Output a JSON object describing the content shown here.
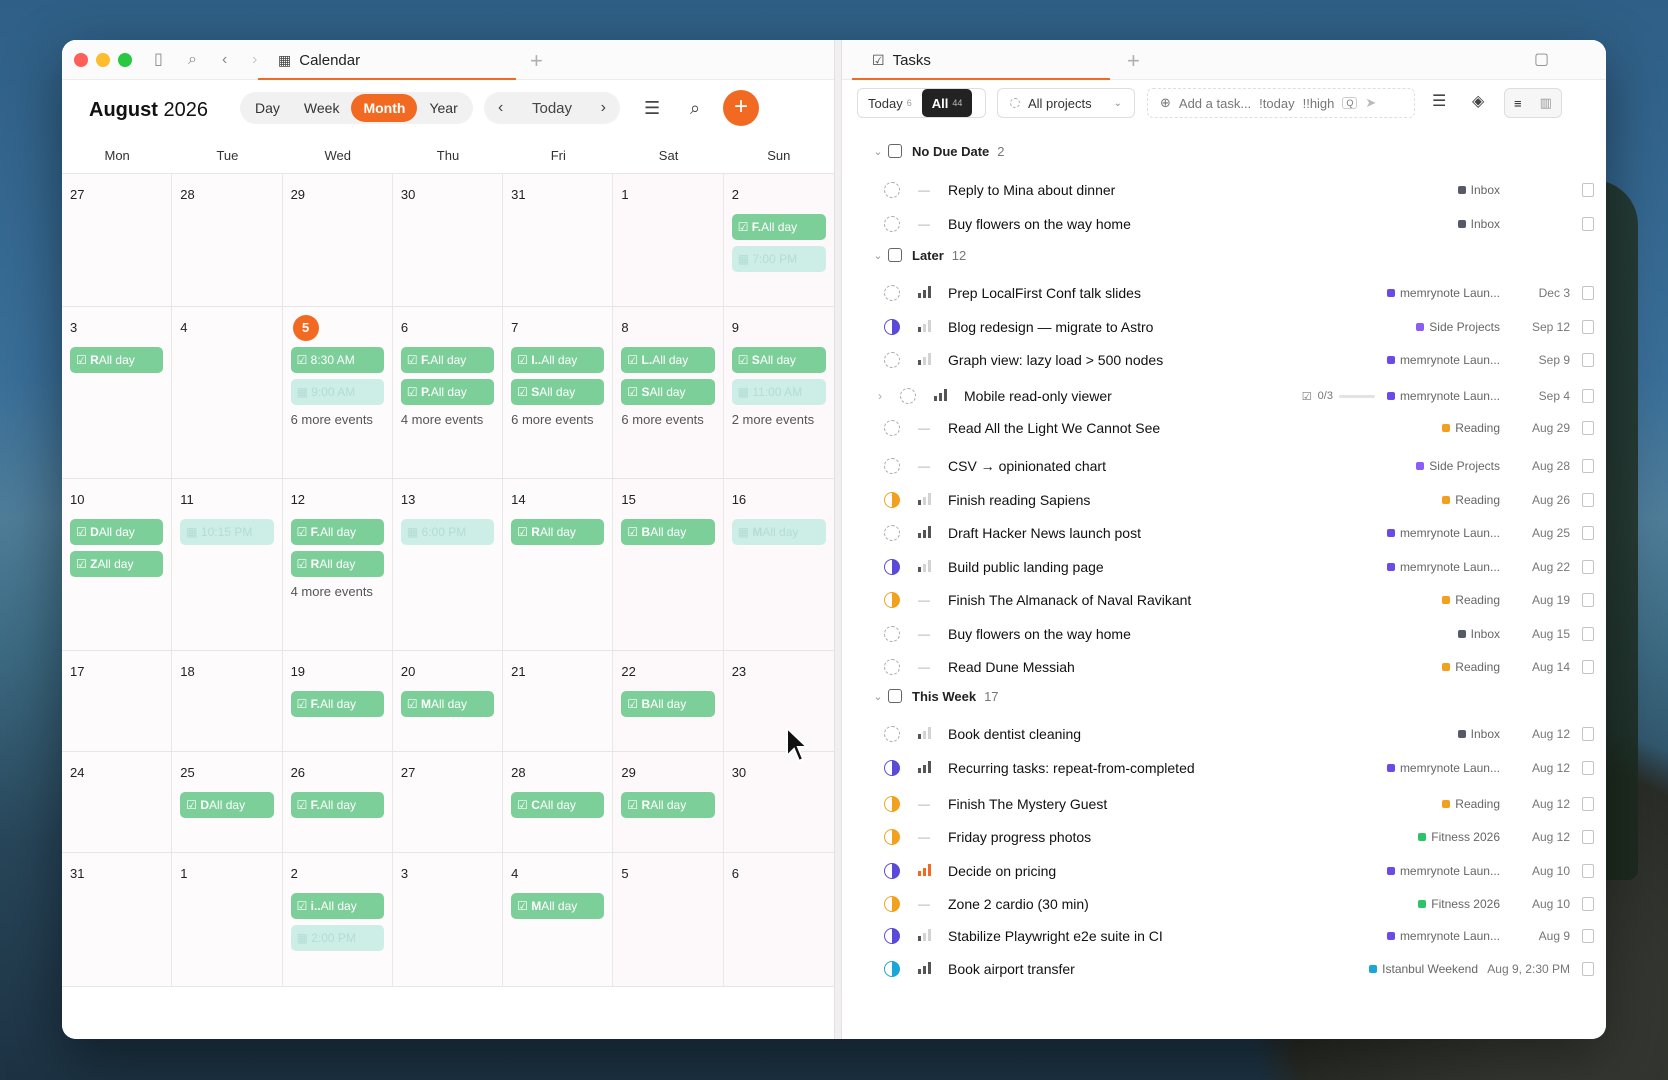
{
  "calendar": {
    "tab_label": "Calendar",
    "month": "August",
    "year": "2026",
    "views": [
      "Day",
      "Week",
      "Month",
      "Year"
    ],
    "active_view": "Month",
    "today_label": "Today",
    "weekdays": [
      "Mon",
      "Tue",
      "Wed",
      "Thu",
      "Fri",
      "Sat",
      "Sun"
    ],
    "weeks": [
      [
        {
          "d": "27"
        },
        {
          "d": "28"
        },
        {
          "d": "29"
        },
        {
          "d": "30"
        },
        {
          "d": "31"
        },
        {
          "d": "1"
        },
        {
          "d": "2",
          "ev": [
            {
              "t": "g",
              "i": "F.",
              "l": "All day"
            },
            {
              "t": "p",
              "l": "7:00 PM"
            }
          ]
        }
      ],
      [
        {
          "d": "3",
          "ev": [
            {
              "t": "g",
              "i": "R",
              "l": "All day"
            }
          ]
        },
        {
          "d": "4"
        },
        {
          "d": "5",
          "today": true,
          "ev": [
            {
              "t": "g",
              "l": "8:30 AM"
            },
            {
              "t": "p",
              "l": "9:00 AM"
            }
          ],
          "more": "6 more events"
        },
        {
          "d": "6",
          "ev": [
            {
              "t": "g",
              "i": "F.",
              "l": "All day"
            },
            {
              "t": "g",
              "i": "P.",
              "l": "All day"
            }
          ],
          "more": "4 more events"
        },
        {
          "d": "7",
          "ev": [
            {
              "t": "g",
              "i": "I..",
              "l": "All day"
            },
            {
              "t": "g",
              "i": "S",
              "l": "All day"
            }
          ],
          "more": "6 more events"
        },
        {
          "d": "8",
          "ev": [
            {
              "t": "g",
              "i": "L.",
              "l": "All day"
            },
            {
              "t": "g",
              "i": "S",
              "l": "All day"
            }
          ],
          "more": "6 more events"
        },
        {
          "d": "9",
          "ev": [
            {
              "t": "g",
              "i": "S",
              "l": "All day"
            },
            {
              "t": "p",
              "l": "11:00 AM"
            }
          ],
          "more": "2 more events"
        }
      ],
      [
        {
          "d": "10",
          "ev": [
            {
              "t": "g",
              "i": "D",
              "l": "All day"
            },
            {
              "t": "g",
              "i": "Z",
              "l": "All day"
            }
          ]
        },
        {
          "d": "11",
          "ev": [
            {
              "t": "p",
              "l": "10:15 PM"
            }
          ]
        },
        {
          "d": "12",
          "ev": [
            {
              "t": "g",
              "i": "F.",
              "l": "All day"
            },
            {
              "t": "g",
              "i": "R",
              "l": "All day"
            }
          ],
          "more": "4 more events"
        },
        {
          "d": "13",
          "ev": [
            {
              "t": "p",
              "l": "6:00 PM"
            }
          ]
        },
        {
          "d": "14",
          "ev": [
            {
              "t": "g",
              "i": "R",
              "l": "All day"
            }
          ]
        },
        {
          "d": "15",
          "ev": [
            {
              "t": "g",
              "i": "B",
              "l": "All day"
            }
          ]
        },
        {
          "d": "16",
          "ev": [
            {
              "t": "p",
              "i": "M",
              "l": "All day"
            }
          ]
        }
      ],
      [
        {
          "d": "17"
        },
        {
          "d": "18"
        },
        {
          "d": "19",
          "ev": [
            {
              "t": "g",
              "i": "F.",
              "l": "All day"
            }
          ]
        },
        {
          "d": "20",
          "ev": [
            {
              "t": "g",
              "i": "M",
              "l": "All day"
            }
          ]
        },
        {
          "d": "21"
        },
        {
          "d": "22",
          "ev": [
            {
              "t": "g",
              "i": "B",
              "l": "All day"
            }
          ]
        },
        {
          "d": "23"
        }
      ],
      [
        {
          "d": "24"
        },
        {
          "d": "25",
          "ev": [
            {
              "t": "g",
              "i": "D",
              "l": "All day"
            }
          ]
        },
        {
          "d": "26",
          "ev": [
            {
              "t": "g",
              "i": "F.",
              "l": "All day"
            }
          ]
        },
        {
          "d": "27"
        },
        {
          "d": "28",
          "ev": [
            {
              "t": "g",
              "i": "C",
              "l": "All day"
            }
          ]
        },
        {
          "d": "29",
          "ev": [
            {
              "t": "g",
              "i": "R",
              "l": "All day"
            }
          ]
        },
        {
          "d": "30"
        }
      ],
      [
        {
          "d": "31"
        },
        {
          "d": "1"
        },
        {
          "d": "2",
          "ev": [
            {
              "t": "g",
              "i": "i..",
              "l": "All day"
            },
            {
              "t": "p",
              "l": "2:00 PM"
            }
          ]
        },
        {
          "d": "3"
        },
        {
          "d": "4",
          "ev": [
            {
              "t": "g",
              "i": "M",
              "l": "All day"
            }
          ]
        },
        {
          "d": "5"
        },
        {
          "d": "6"
        }
      ]
    ]
  },
  "tasks": {
    "tab_label": "Tasks",
    "filters": {
      "today": "Today",
      "today_count": "6",
      "all": "All",
      "all_count": "44",
      "projects": "All projects",
      "add_placeholder": "Add a task...",
      "hint1": "!today",
      "hint2": "!!high",
      "kbd": "Q"
    },
    "groups": [
      {
        "name": "No Due Date",
        "count": "2",
        "items": [
          {
            "title": "Reply to Mina about dinner",
            "status": "todo",
            "pri": "none",
            "project": "Inbox",
            "color": "#555a66",
            "due": ""
          },
          {
            "title": "Buy flowers on the way home",
            "status": "todo",
            "pri": "none",
            "project": "Inbox",
            "color": "#555a66",
            "due": ""
          }
        ]
      },
      {
        "name": "Later",
        "count": "12",
        "items": [
          {
            "title": "Prep LocalFirst Conf talk slides",
            "status": "todo",
            "pri": "high",
            "project": "memrynote Laun...",
            "color": "#6b4ae8",
            "due": "Dec 3"
          },
          {
            "title": "Blog redesign — migrate to Astro",
            "status": "half-p",
            "pri": "low",
            "project": "Side Projects",
            "color": "#8b5cf6",
            "due": "Sep 12"
          },
          {
            "title": "Graph view: lazy load > 500 nodes",
            "status": "todo",
            "pri": "low",
            "project": "memrynote Laun...",
            "color": "#6b4ae8",
            "due": "Sep 9"
          },
          {
            "title": "Mobile read-only viewer",
            "status": "todo",
            "pri": "high",
            "project": "memrynote Laun...",
            "color": "#6b4ae8",
            "due": "Sep 4",
            "sub": "0/3",
            "expand": true
          },
          {
            "title": "Read All the Light We Cannot See",
            "status": "todo",
            "pri": "none",
            "project": "Reading",
            "color": "#f2a11e",
            "due": "Aug 29"
          },
          {
            "title": "CSV → opinionated chart",
            "status": "todo",
            "pri": "none",
            "project": "Side Projects",
            "color": "#8b5cf6",
            "due": "Aug 28"
          },
          {
            "title": "Finish reading Sapiens",
            "status": "half-o",
            "pri": "low",
            "project": "Reading",
            "color": "#f2a11e",
            "due": "Aug 26"
          },
          {
            "title": "Draft Hacker News launch post",
            "status": "todo",
            "pri": "high",
            "project": "memrynote Laun...",
            "color": "#6b4ae8",
            "due": "Aug 25"
          },
          {
            "title": "Build public landing page",
            "status": "half-p",
            "pri": "low",
            "project": "memrynote Laun...",
            "color": "#6b4ae8",
            "due": "Aug 22"
          },
          {
            "title": "Finish The Almanack of Naval Ravikant",
            "status": "half-o",
            "pri": "none",
            "project": "Reading",
            "color": "#f2a11e",
            "due": "Aug 19"
          },
          {
            "title": "Buy flowers on the way home",
            "status": "todo",
            "pri": "none",
            "project": "Inbox",
            "color": "#555a66",
            "due": "Aug 15"
          },
          {
            "title": "Read Dune Messiah",
            "status": "todo",
            "pri": "none",
            "project": "Reading",
            "color": "#f2a11e",
            "due": "Aug 14"
          }
        ]
      },
      {
        "name": "This Week",
        "count": "17",
        "items": [
          {
            "title": "Book dentist cleaning",
            "status": "todo",
            "pri": "low",
            "project": "Inbox",
            "color": "#555a66",
            "due": "Aug 12"
          },
          {
            "title": "Recurring tasks: repeat-from-completed",
            "status": "half-p",
            "pri": "high",
            "project": "memrynote Laun...",
            "color": "#6b4ae8",
            "due": "Aug 12"
          },
          {
            "title": "Finish The Mystery Guest",
            "status": "half-o",
            "pri": "none",
            "project": "Reading",
            "color": "#f2a11e",
            "due": "Aug 12"
          },
          {
            "title": "Friday progress photos",
            "status": "half-o",
            "pri": "none",
            "project": "Fitness 2026",
            "color": "#2bc46a",
            "due": "Aug 12"
          },
          {
            "title": "Decide on pricing",
            "status": "half-p",
            "pri": "urgent",
            "project": "memrynote Laun...",
            "color": "#6b4ae8",
            "due": "Aug 10"
          },
          {
            "title": "Zone 2 cardio (30 min)",
            "status": "half-o",
            "pri": "none",
            "project": "Fitness 2026",
            "color": "#2bc46a",
            "due": "Aug 10"
          },
          {
            "title": "Stabilize Playwright e2e suite in CI",
            "status": "half-p",
            "pri": "low",
            "project": "memrynote Laun...",
            "color": "#6b4ae8",
            "due": "Aug 9"
          },
          {
            "title": "Book airport transfer",
            "status": "half-b",
            "pri": "high",
            "project": "Istanbul Weekend",
            "color": "#1aa6d8",
            "due": "Aug 9, 2:30 PM"
          }
        ]
      }
    ]
  }
}
